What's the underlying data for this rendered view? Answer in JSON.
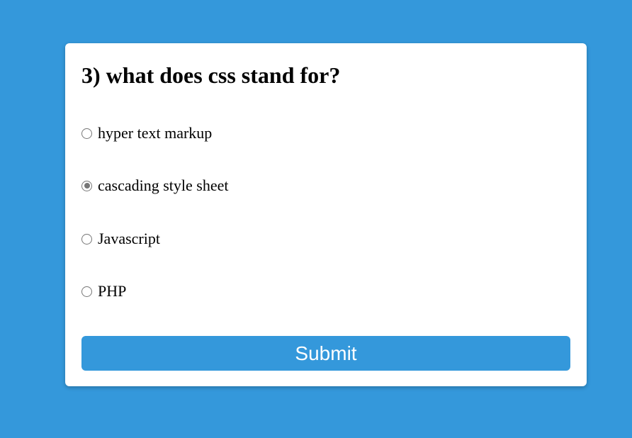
{
  "colors": {
    "background": "#3498db",
    "card": "#ffffff",
    "button": "#3498db",
    "button_text": "#ffffff",
    "radio_border": "#767676"
  },
  "quiz": {
    "question": "3) what does css stand for?",
    "options": [
      {
        "label": "hyper text markup",
        "checked": false
      },
      {
        "label": "cascading style sheet",
        "checked": true
      },
      {
        "label": "Javascript",
        "checked": false
      },
      {
        "label": "PHP",
        "checked": false
      }
    ],
    "submit_label": "Submit"
  }
}
